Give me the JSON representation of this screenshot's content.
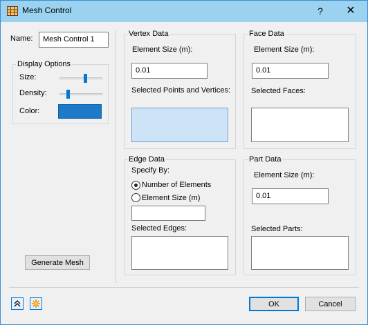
{
  "window": {
    "title": "Mesh Control",
    "help_glyph": "?",
    "close_glyph": "✕"
  },
  "left": {
    "name_label": "Name:",
    "name_value": "Mesh Control 1",
    "display_options": {
      "title": "Display Options",
      "size_label": "Size:",
      "size_level": 0.62,
      "density_label": "Density:",
      "density_level": 0.18,
      "color_label": "Color:",
      "color": "#1e7ac8"
    },
    "generate_label": "Generate Mesh"
  },
  "vertex": {
    "title": "Vertex Data",
    "size_label": "Element Size (m):",
    "size_value": "0.01",
    "selected_label": "Selected Points and Vertices:"
  },
  "face": {
    "title": "Face Data",
    "size_label": "Element Size (m):",
    "size_value": "0.01",
    "selected_label": "Selected Faces:"
  },
  "edge": {
    "title": "Edge Data",
    "specify_label": "Specify By:",
    "option_count": "Number of Elements",
    "option_size": "Element Size (m)",
    "size_value": "",
    "selected_label": "Selected Edges:"
  },
  "part": {
    "title": "Part Data",
    "size_label": "Element Size (m):",
    "size_value": "0.01",
    "selected_label": "Selected Parts:"
  },
  "footer": {
    "collapse_icon": "double-chevron-up-icon",
    "highlight_icon": "starburst-icon",
    "ok_label": "OK",
    "cancel_label": "Cancel"
  },
  "colors": {
    "titlebar": "#9ad2ef",
    "accent": "#0078d7",
    "selected_list": "#cde3f7",
    "swatch": "#1e7ac8"
  }
}
